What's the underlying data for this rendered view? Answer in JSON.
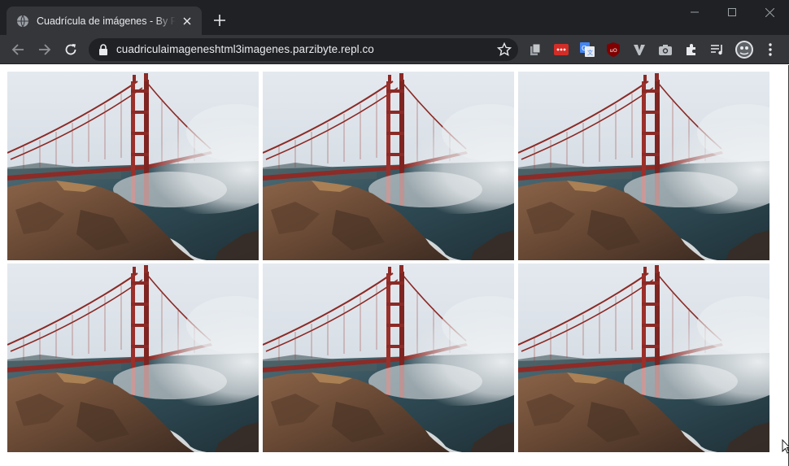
{
  "tab": {
    "title": "Cuadrícula de imágenes - By Parzibyte"
  },
  "address_bar": {
    "url": "cuadriculaimageneshtml3imagenes.parzibyte.repl.co"
  },
  "extensions": [
    "collections-icon",
    "lastpass-icon",
    "google-translate-icon",
    "ublock-origin-icon",
    "vimium-icon",
    "screenshot-camera-icon",
    "puzzle-extensions-icon",
    "media-controls-icon"
  ],
  "colors": {
    "titlebar": "#202124",
    "toolbar": "#35363a",
    "omnibox": "#202124",
    "bridge_red": "#9b2f2a",
    "sky": "#dfe5ec",
    "water": "#314a55",
    "cliff": "#6a4a35"
  },
  "gallery": {
    "columns": 3,
    "rows": 2,
    "images": [
      {
        "subject": "Golden Gate Bridge in fog"
      },
      {
        "subject": "Golden Gate Bridge in fog"
      },
      {
        "subject": "Golden Gate Bridge in fog"
      },
      {
        "subject": "Golden Gate Bridge in fog"
      },
      {
        "subject": "Golden Gate Bridge in fog"
      },
      {
        "subject": "Golden Gate Bridge in fog"
      }
    ]
  }
}
